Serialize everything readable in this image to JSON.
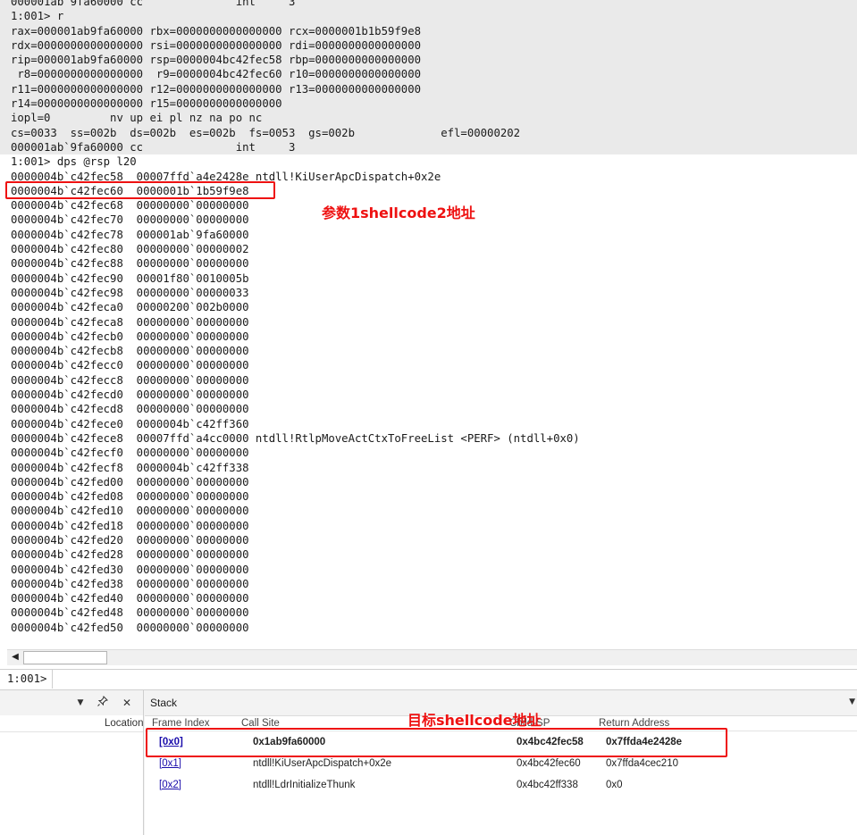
{
  "command_window": {
    "lines": [
      {
        "text": "000001ab`9fa60000 cc              int     3",
        "shaded": true
      },
      {
        "text": "1:001> r",
        "shaded": true
      },
      {
        "text": "rax=000001ab9fa60000 rbx=0000000000000000 rcx=0000001b1b59f9e8",
        "shaded": true
      },
      {
        "text": "rdx=0000000000000000 rsi=0000000000000000 rdi=0000000000000000",
        "shaded": true
      },
      {
        "text": "rip=000001ab9fa60000 rsp=0000004bc42fec58 rbp=0000000000000000",
        "shaded": true
      },
      {
        "text": " r8=0000000000000000  r9=0000004bc42fec60 r10=0000000000000000",
        "shaded": true
      },
      {
        "text": "r11=0000000000000000 r12=0000000000000000 r13=0000000000000000",
        "shaded": true
      },
      {
        "text": "r14=0000000000000000 r15=0000000000000000",
        "shaded": true
      },
      {
        "text": "iopl=0         nv up ei pl nz na po nc",
        "shaded": true
      },
      {
        "text": "cs=0033  ss=002b  ds=002b  es=002b  fs=0053  gs=002b             efl=00000202",
        "shaded": true
      },
      {
        "text": "000001ab`9fa60000 cc              int     3",
        "shaded": true
      },
      {
        "text": "1:001> dps @rsp l20",
        "shaded": false
      },
      {
        "text": "0000004b`c42fec58  00007ffd`a4e2428e ntdll!KiUserApcDispatch+0x2e",
        "shaded": false
      },
      {
        "text": "0000004b`c42fec60  0000001b`1b59f9e8",
        "shaded": false
      },
      {
        "text": "0000004b`c42fec68  00000000`00000000",
        "shaded": false
      },
      {
        "text": "0000004b`c42fec70  00000000`00000000",
        "shaded": false
      },
      {
        "text": "0000004b`c42fec78  000001ab`9fa60000",
        "shaded": false
      },
      {
        "text": "0000004b`c42fec80  00000000`00000002",
        "shaded": false
      },
      {
        "text": "0000004b`c42fec88  00000000`00000000",
        "shaded": false
      },
      {
        "text": "0000004b`c42fec90  00001f80`0010005b",
        "shaded": false
      },
      {
        "text": "0000004b`c42fec98  00000000`00000033",
        "shaded": false
      },
      {
        "text": "0000004b`c42feca0  00000200`002b0000",
        "shaded": false
      },
      {
        "text": "0000004b`c42feca8  00000000`00000000",
        "shaded": false
      },
      {
        "text": "0000004b`c42fecb0  00000000`00000000",
        "shaded": false
      },
      {
        "text": "0000004b`c42fecb8  00000000`00000000",
        "shaded": false
      },
      {
        "text": "0000004b`c42fecc0  00000000`00000000",
        "shaded": false
      },
      {
        "text": "0000004b`c42fecc8  00000000`00000000",
        "shaded": false
      },
      {
        "text": "0000004b`c42fecd0  00000000`00000000",
        "shaded": false
      },
      {
        "text": "0000004b`c42fecd8  00000000`00000000",
        "shaded": false
      },
      {
        "text": "0000004b`c42fece0  0000004b`c42ff360",
        "shaded": false
      },
      {
        "text": "0000004b`c42fece8  00007ffd`a4cc0000 ntdll!RtlpMoveActCtxToFreeList <PERF> (ntdll+0x0)",
        "shaded": false
      },
      {
        "text": "0000004b`c42fecf0  00000000`00000000",
        "shaded": false
      },
      {
        "text": "0000004b`c42fecf8  0000004b`c42ff338",
        "shaded": false
      },
      {
        "text": "0000004b`c42fed00  00000000`00000000",
        "shaded": false
      },
      {
        "text": "0000004b`c42fed08  00000000`00000000",
        "shaded": false
      },
      {
        "text": "0000004b`c42fed10  00000000`00000000",
        "shaded": false
      },
      {
        "text": "0000004b`c42fed18  00000000`00000000",
        "shaded": false
      },
      {
        "text": "0000004b`c42fed20  00000000`00000000",
        "shaded": false
      },
      {
        "text": "0000004b`c42fed28  00000000`00000000",
        "shaded": false
      },
      {
        "text": "0000004b`c42fed30  00000000`00000000",
        "shaded": false
      },
      {
        "text": "0000004b`c42fed38  00000000`00000000",
        "shaded": false
      },
      {
        "text": "0000004b`c42fed40  00000000`00000000",
        "shaded": false
      },
      {
        "text": "0000004b`c42fed48  00000000`00000000",
        "shaded": false
      },
      {
        "text": "0000004b`c42fed50  00000000`00000000",
        "shaded": false
      }
    ],
    "prompt": "1:001>",
    "input_value": ""
  },
  "annotations": {
    "param_label": "参数1shellcode2地址",
    "target_label": "目标shellcode地址"
  },
  "left_panel": {
    "location_header": "Location",
    "icons": {
      "dropdown": "chevron-down-icon",
      "pin": "pin-icon",
      "close": "close-icon"
    }
  },
  "stack": {
    "title": "Stack",
    "columns": {
      "frame_index": "Frame Index",
      "call_site": "Call Site",
      "child_sp": "Child-SP",
      "return_address": "Return Address"
    },
    "rows": [
      {
        "frame_index": "[0x0]",
        "call_site": "0x1ab9fa60000",
        "child_sp": "0x4bc42fec58",
        "return_address": "0x7ffda4e2428e"
      },
      {
        "frame_index": "[0x1]",
        "call_site": "ntdll!KiUserApcDispatch+0x2e",
        "child_sp": "0x4bc42fec60",
        "return_address": "0x7ffda4cec210"
      },
      {
        "frame_index": "[0x2]",
        "call_site": "ntdll!LdrInitializeThunk",
        "child_sp": "0x4bc42ff338",
        "return_address": "0x0"
      }
    ]
  },
  "colors": {
    "highlight": "#ee1111",
    "shaded": "#eaeaea",
    "link": "#1a0dab"
  }
}
